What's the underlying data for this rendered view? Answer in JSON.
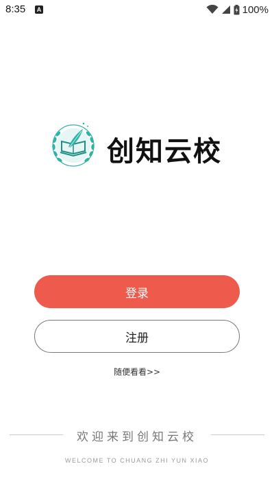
{
  "status_bar": {
    "time": "8:35",
    "notification_icon": "A",
    "battery_percent": "100%",
    "icons": [
      "wifi-icon",
      "cellular-signal-icon",
      "battery-charging-icon"
    ]
  },
  "logo": {
    "title": "创知云校",
    "emblem_icon": "book-feather-laurel-icon",
    "emblem_color": "#2eb3a6"
  },
  "actions": {
    "login_label": "登录",
    "register_label": "注册",
    "browse_label": "随便看看>>"
  },
  "footer": {
    "welcome_text": "欢迎来到创知云校",
    "welcome_sub": "WELCOME TO CHUANG ZHI YUN XIAO"
  },
  "colors": {
    "login_button": "#ee5a4c",
    "register_border": "#777777",
    "accent_teal": "#2eb3a6"
  }
}
